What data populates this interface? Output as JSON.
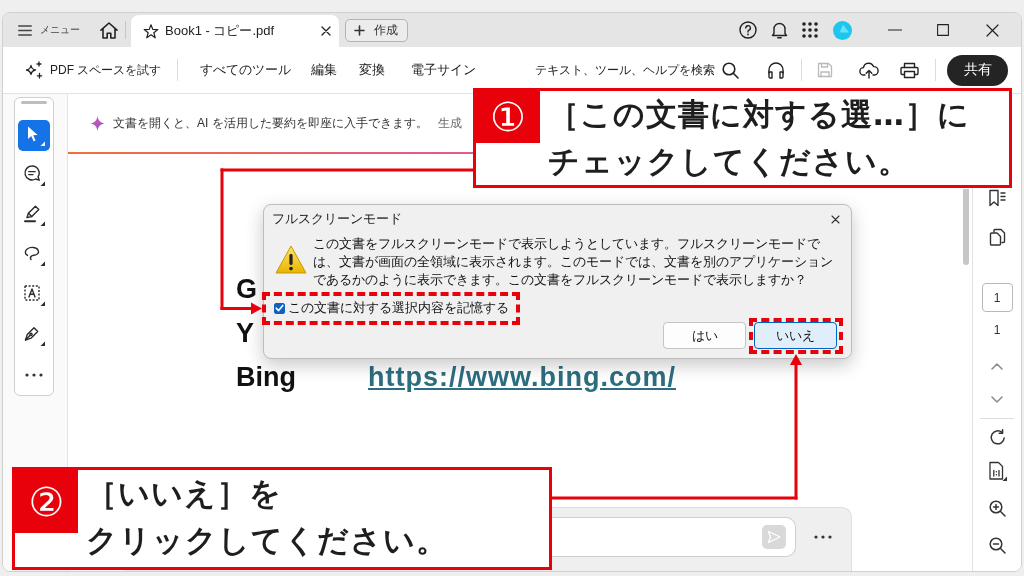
{
  "title_bar": {
    "menu_label": "メニュー",
    "tabs": [
      {
        "title": "Book1 - コピー.pdf",
        "selected": true
      }
    ],
    "new_button": "作成"
  },
  "toolbar": {
    "try_spaces": "PDF スペースを試す",
    "menus": [
      "すべてのツール",
      "編集",
      "変換",
      "電子サイン"
    ],
    "search_label": "テキスト、ツール、ヘルプを検索",
    "save": {
      "disabled": true
    },
    "share_button": "共有"
  },
  "tool_rail": {
    "tools": [
      {
        "kind": "select",
        "selected": true
      },
      {
        "kind": "comment",
        "selected": false
      },
      {
        "kind": "highlight",
        "selected": false
      },
      {
        "kind": "draw",
        "selected": false
      },
      {
        "kind": "text-select",
        "selected": false
      },
      {
        "kind": "sign",
        "selected": false
      }
    ]
  },
  "banner": {
    "text": "文書を開くと、AI を活用した要約を即座に入手できます。",
    "link": "生成"
  },
  "document": {
    "rows": [
      {
        "name": "G"
      },
      {
        "name": "Y"
      },
      {
        "name": "Bing",
        "url": "https://www.bing.com/"
      }
    ]
  },
  "page_nav": {
    "page": "1",
    "page_count": "1"
  },
  "dialog": {
    "title": "フルスクリーンモード",
    "message": "この文書をフルスクリーンモードで表示しようとしています。フルスクリーンモードでは、文書が画面の全領域に表示されます。このモードでは、文書を別のアプリケーションであるかのように表示できます。この文書をフルスクリーンモードで表示しますか？",
    "remember": {
      "label": "この文書に対する選択内容を記憶する",
      "checked": true
    },
    "buttons": [
      {
        "label": "はい",
        "focused": false
      },
      {
        "label": "いいえ",
        "focused": true
      }
    ]
  },
  "callouts": [
    {
      "number": "①",
      "lines": [
        "［この文書に対する選…］に",
        "チェックしてください。"
      ]
    },
    {
      "number": "②",
      "lines": [
        "［いいえ］を",
        "クリックしてください。"
      ]
    }
  ]
}
